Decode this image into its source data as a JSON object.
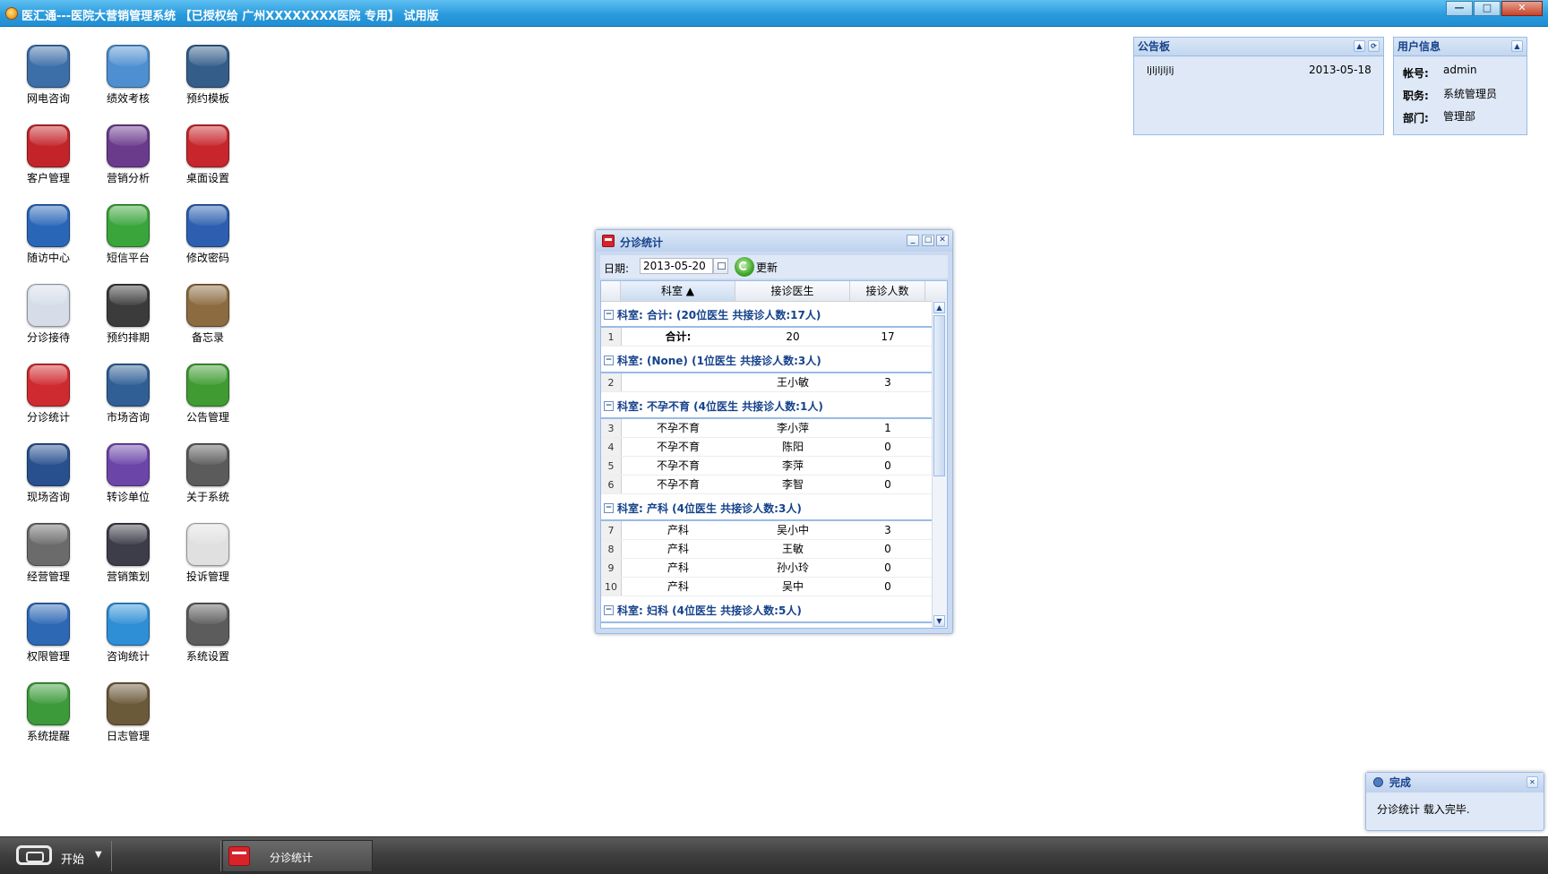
{
  "window": {
    "title": "医汇通---医院大营销管理系统 【已授权给 广州XXXXXXXX医院 专用】 试用版",
    "buttons": [
      "—",
      "□",
      "✕"
    ]
  },
  "desktop_icons": [
    {
      "label": "网电咨询",
      "icon": "chat-bubble-icon",
      "color": "#3c6ea8"
    },
    {
      "label": "绩效考核",
      "icon": "graph-curve-icon",
      "color": "#4d8fd0"
    },
    {
      "label": "预约模板",
      "icon": "photo-album-icon",
      "color": "#345d8a"
    },
    {
      "label": "客户管理",
      "icon": "user-avatar-icon",
      "color": "#c3242a"
    },
    {
      "label": "营销分析",
      "icon": "pie-chart-icon",
      "color": "#6a3b8c"
    },
    {
      "label": "桌面设置",
      "icon": "monitor-icon",
      "color": "#c7262c"
    },
    {
      "label": "随访中心",
      "icon": "contact-card-icon",
      "color": "#2a66b8"
    },
    {
      "label": "短信平台",
      "icon": "sms-icon",
      "color": "#3aa53a"
    },
    {
      "label": "修改密码",
      "icon": "key-icon",
      "color": "#2d5fb0"
    },
    {
      "label": "分诊接待",
      "icon": "checkmark-icon",
      "color": "#d6dde8"
    },
    {
      "label": "预约排期",
      "icon": "calendar-display-icon",
      "color": "#3b3b3b"
    },
    {
      "label": "备忘录",
      "icon": "address-book-icon",
      "color": "#8b6b3f"
    },
    {
      "label": "分诊统计",
      "icon": "calendar-icon",
      "color": "#cf2a2f"
    },
    {
      "label": "市场咨询",
      "icon": "signal-icon",
      "color": "#2f5f94"
    },
    {
      "label": "公告管理",
      "icon": "broadcast-icon",
      "color": "#3f9b32"
    },
    {
      "label": "现场咨询",
      "icon": "monitor-graph-icon",
      "color": "#28508e"
    },
    {
      "label": "转诊单位",
      "icon": "briefcase-icon",
      "color": "#6b45a8"
    },
    {
      "label": "关于系统",
      "icon": "camera-lens-icon",
      "color": "#5b5b5b"
    },
    {
      "label": "经营管理",
      "icon": "calculator-icon",
      "color": "#6b6b6b"
    },
    {
      "label": "营销策划",
      "icon": "drafting-compass-icon",
      "color": "#3d3d4a"
    },
    {
      "label": "投诉管理",
      "icon": "pen-paper-icon",
      "color": "#e0e0e0"
    },
    {
      "label": "权限管理",
      "icon": "user-group-icon",
      "color": "#2d68b5"
    },
    {
      "label": "咨询统计",
      "icon": "line-chart-icon",
      "color": "#2f8fd6"
    },
    {
      "label": "系统设置",
      "icon": "gear-icon",
      "color": "#5c5c5c"
    },
    {
      "label": "系统提醒",
      "icon": "alarm-clock-icon",
      "color": "#3c9a3a"
    },
    {
      "label": "日志管理",
      "icon": "notepad-icon",
      "color": "#6b5a3a"
    }
  ],
  "notice_board": {
    "title": "公告板",
    "item_text": "ljljljljlj",
    "item_date": "2013-05-18",
    "tools": [
      "▲",
      "⟳"
    ]
  },
  "user_info": {
    "title": "用户信息",
    "tool": "▲",
    "account_label": "帐号:",
    "account_value": "admin",
    "position_label": "职务:",
    "position_value": "系统管理员",
    "dept_label": "部门:",
    "dept_value": "管理部"
  },
  "dialog": {
    "title": "分诊统计",
    "tools": [
      "_",
      "□",
      "✕"
    ],
    "date_label": "日期:",
    "date_value": "2013-05-20",
    "refresh_label": "更新",
    "columns": [
      "科室 ▲",
      "接诊医生",
      "接诊人数"
    ],
    "groups": [
      {
        "header": "科室: 合计: (20位医生 共接诊人数:17人)",
        "rows": [
          {
            "n": "1",
            "dept": "合计:",
            "doctor": "20",
            "count": "17",
            "bold": true
          }
        ]
      },
      {
        "header": "科室: (None) (1位医生 共接诊人数:3人)",
        "rows": [
          {
            "n": "2",
            "dept": "",
            "doctor": "王小敏",
            "count": "3"
          }
        ]
      },
      {
        "header": "科室: 不孕不育 (4位医生 共接诊人数:1人)",
        "rows": [
          {
            "n": "3",
            "dept": "不孕不育",
            "doctor": "李小萍",
            "count": "1"
          },
          {
            "n": "4",
            "dept": "不孕不育",
            "doctor": "陈阳",
            "count": "0"
          },
          {
            "n": "5",
            "dept": "不孕不育",
            "doctor": "李萍",
            "count": "0"
          },
          {
            "n": "6",
            "dept": "不孕不育",
            "doctor": "李智",
            "count": "0"
          }
        ]
      },
      {
        "header": "科室: 产科 (4位医生 共接诊人数:3人)",
        "rows": [
          {
            "n": "7",
            "dept": "产科",
            "doctor": "吴小中",
            "count": "3"
          },
          {
            "n": "8",
            "dept": "产科",
            "doctor": "王敏",
            "count": "0"
          },
          {
            "n": "9",
            "dept": "产科",
            "doctor": "孙小玲",
            "count": "0"
          },
          {
            "n": "10",
            "dept": "产科",
            "doctor": "吴中",
            "count": "0"
          }
        ]
      },
      {
        "header": "科室: 妇科 (4位医生 共接诊人数:5人)",
        "rows": []
      }
    ]
  },
  "toast": {
    "title": "完成",
    "close": "✕",
    "message": "分诊统计 载入完毕."
  },
  "taskbar": {
    "start_label": "开始",
    "start_arrow": "▼",
    "task_label": "分诊统计"
  }
}
